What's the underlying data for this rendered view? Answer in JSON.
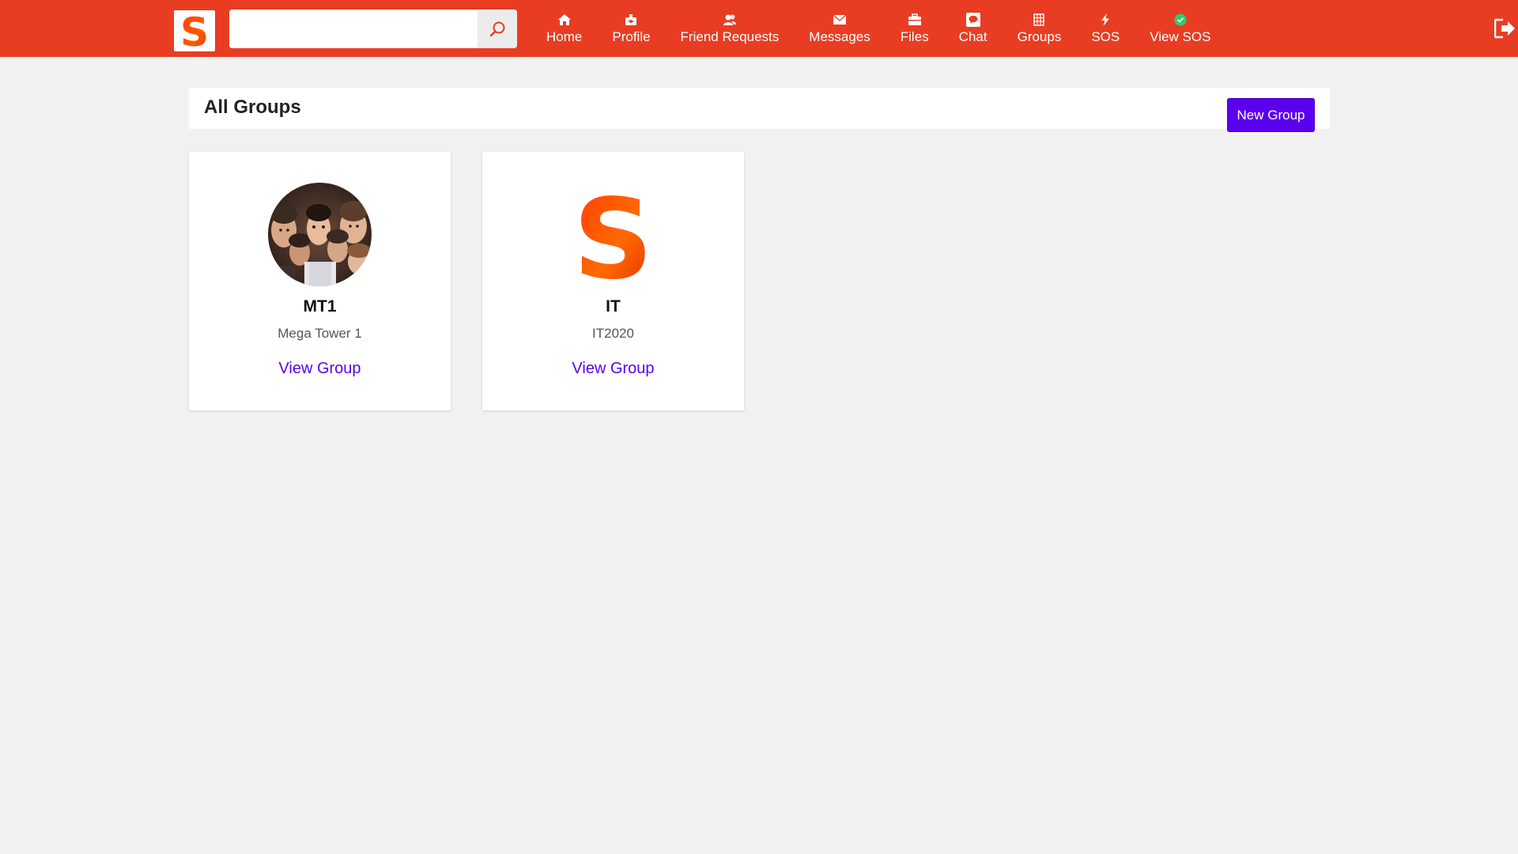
{
  "navbar": {
    "logo_letter": "S",
    "search_placeholder": "",
    "items": [
      {
        "label": "Home",
        "icon": "home-icon"
      },
      {
        "label": "Profile",
        "icon": "profile-icon"
      },
      {
        "label": "Friend Requests",
        "icon": "friend-requests-icon"
      },
      {
        "label": "Messages",
        "icon": "envelope-icon"
      },
      {
        "label": "Files",
        "icon": "briefcase-icon"
      },
      {
        "label": "Chat",
        "icon": "chat-icon"
      },
      {
        "label": "Groups",
        "icon": "grid-icon"
      },
      {
        "label": "SOS",
        "icon": "bolt-icon"
      },
      {
        "label": "View SOS",
        "icon": "green-dot-icon"
      }
    ],
    "logout_icon": "logout-icon"
  },
  "header": {
    "title": "All Groups",
    "new_group_label": "New Group"
  },
  "groups": [
    {
      "name": "MT1",
      "description": "Mega Tower 1",
      "link_label": "View Group",
      "image": "group-photo"
    },
    {
      "name": "IT",
      "description": "IT2020",
      "link_label": "View Group",
      "image": "s-logo"
    }
  ],
  "colors": {
    "navbar_bg": "#e83d22",
    "accent": "#5a00ee",
    "page_bg": "#f1f1f1",
    "sos_dot": "#2ecc71"
  }
}
